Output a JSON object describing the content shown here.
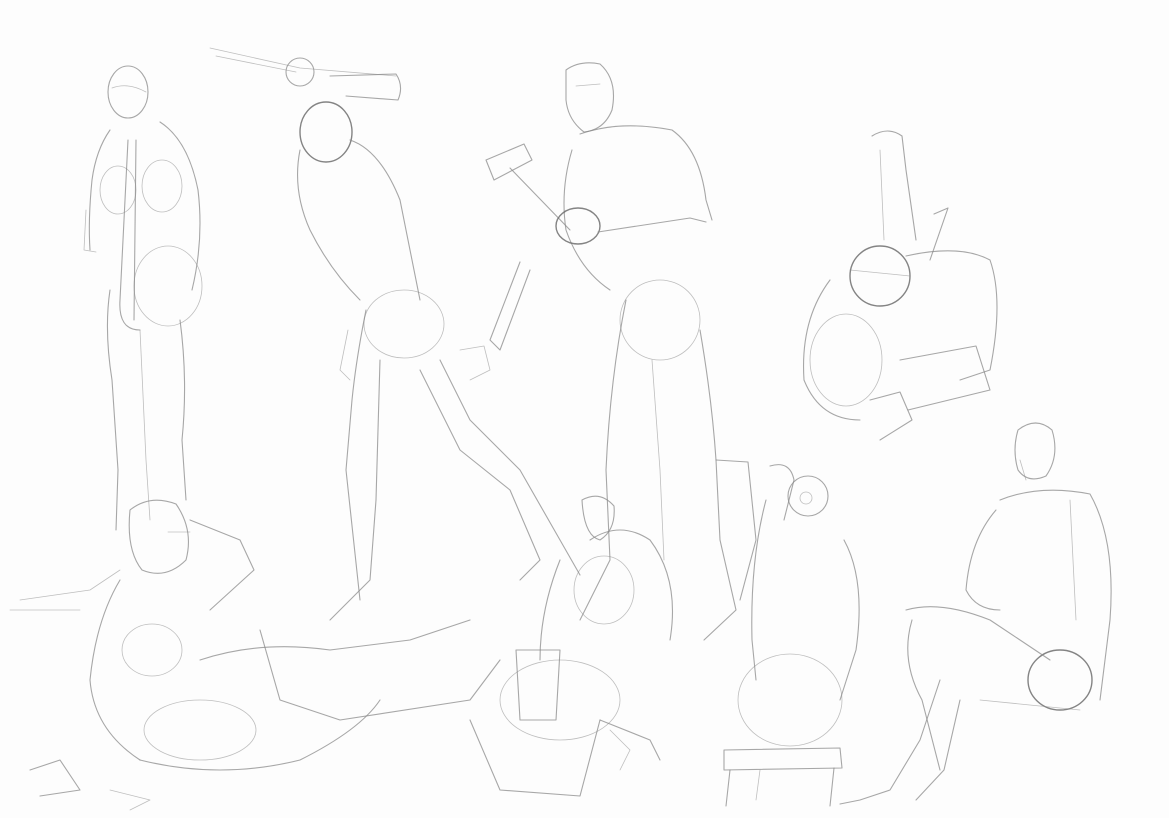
{
  "page": {
    "background_color": "#fdfdfd"
  },
  "drawing": {
    "medium": "pencil",
    "stroke_color": "#8a8a8a",
    "stroke_color_dark": "#6f6f6f",
    "figures": [
      {
        "id": "standing-female",
        "icon": "figure-standing-icon"
      },
      {
        "id": "reaching-figure",
        "icon": "figure-reaching-icon"
      },
      {
        "id": "hammer-figure",
        "icon": "figure-hammer-icon"
      },
      {
        "id": "crouching-figure",
        "icon": "figure-crouching-icon"
      },
      {
        "id": "reclining-figure",
        "icon": "figure-reclining-icon"
      },
      {
        "id": "kneeling-figure",
        "icon": "figure-kneeling-icon"
      },
      {
        "id": "stool-figure",
        "icon": "figure-seated-stool-icon"
      },
      {
        "id": "seated-figure",
        "icon": "figure-seated-icon"
      }
    ]
  }
}
